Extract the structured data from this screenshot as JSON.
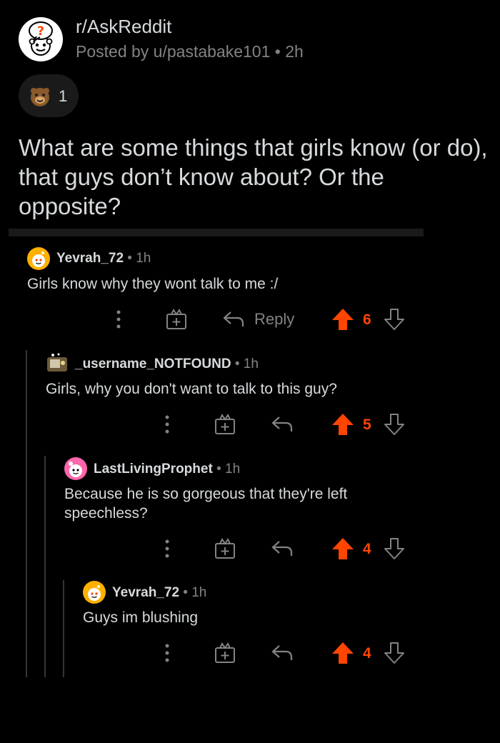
{
  "post": {
    "subreddit": "r/AskReddit",
    "meta": "Posted by u/pastabake101 • 2h",
    "award_count": "1",
    "title": "What are some things that girls know (or do), that guys don’t know about? Or the opposite?"
  },
  "comments": [
    {
      "user": "Yevrah_72",
      "time": " • 1h",
      "body": "Girls know why they wont talk to me :/",
      "reply_label": "Reply",
      "votes": "6"
    },
    {
      "user": "_username_NOTFOUND",
      "time": " • 1h",
      "body": "Girls, why you don't want to talk to this guy?",
      "votes": "5"
    },
    {
      "user": "LastLivingProphet",
      "time": " • 1h",
      "body": "Because he is so gorgeous that they're left speechless?",
      "votes": "4"
    },
    {
      "user": "Yevrah_72",
      "time": " • 1h",
      "body": "Guys im blushing",
      "votes": "4"
    }
  ],
  "colors": {
    "background": "#000000",
    "text": "#d7dadc",
    "meta": "#818384",
    "upvote": "#ff4500",
    "thread_line": "#343536"
  },
  "icons": [
    "askreddit-icon",
    "award-icon",
    "more-options-icon",
    "gift-icon",
    "reply-icon",
    "upvote-icon",
    "downvote-icon"
  ]
}
